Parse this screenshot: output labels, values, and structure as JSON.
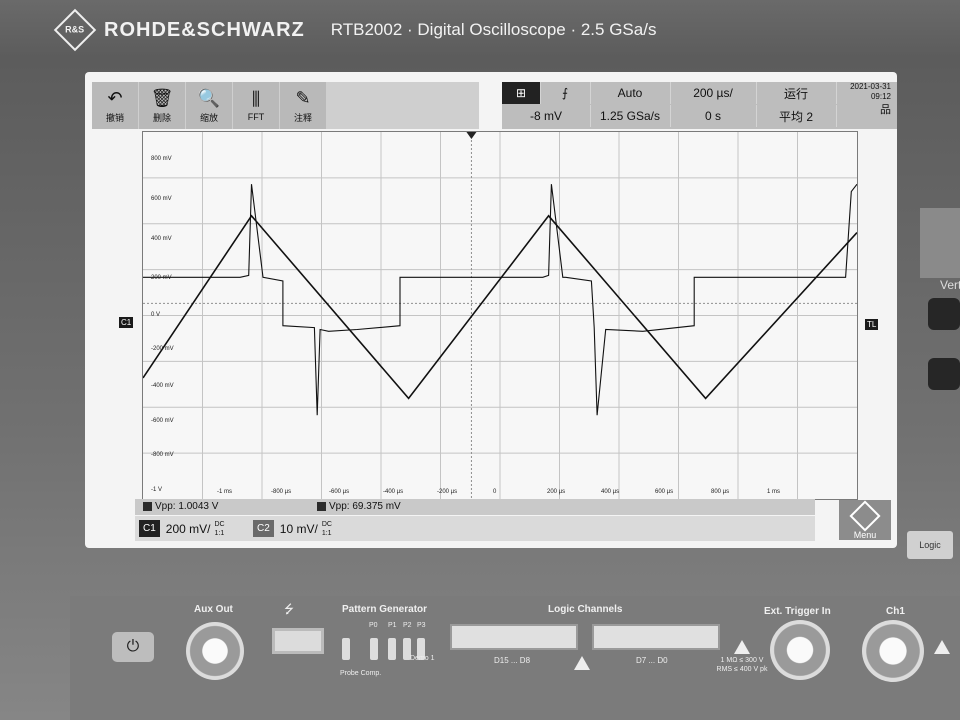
{
  "header": {
    "brand": "ROHDE&SCHWARZ",
    "model": "RTB2002 · Digital Oscilloscope · 2.5 GSa/s",
    "logo_letters": "R&S"
  },
  "toolbar": [
    {
      "label": "撤销",
      "icon": "undo-icon",
      "glyph": "↶"
    },
    {
      "label": "删除",
      "icon": "trash-icon",
      "glyph": "🗑"
    },
    {
      "label": "缩放",
      "icon": "zoom-icon",
      "glyph": "🔍"
    },
    {
      "label": "FFT",
      "icon": "fft-icon",
      "glyph": "⫼"
    },
    {
      "label": "注释",
      "icon": "pencil-icon",
      "glyph": "✎"
    }
  ],
  "status": {
    "trigger_level": "-8 mV",
    "trigger_mode": "Auto",
    "sample_rate": "1.25 GSa/s",
    "timebase": "200 µs/",
    "time_offset": "0 s",
    "run_state": "运行",
    "acquire": "平均 2",
    "date": "2021-03-31",
    "time": "09:12",
    "edge_symbol": "⨍"
  },
  "y_ticks": [
    "800 mV",
    "600 mV",
    "400 mV",
    "200 mV",
    "0 V",
    "-200 mV",
    "-400 mV",
    "-600 mV",
    "-800 mV",
    "-1 V"
  ],
  "x_ticks": [
    "-1 ms",
    "-800 µs",
    "-600 µs",
    "-400 µs",
    "-200 µs",
    "0",
    "200 µs",
    "400 µs",
    "600 µs",
    "800 µs",
    "1 ms"
  ],
  "markers": {
    "ch_left": "C1",
    "trig_right": "TL"
  },
  "measurements": [
    {
      "label": "Vpp: 1.0043 V"
    },
    {
      "label": "Vpp: 69.375 mV"
    }
  ],
  "channels": [
    {
      "tag": "C1",
      "scale": "200 mV/",
      "coupling": "DC",
      "impedance": "1:1"
    },
    {
      "tag": "C2",
      "scale": "10 mV/",
      "coupling": "DC",
      "impedance": "1:1"
    }
  ],
  "menu_label": "Menu",
  "side": {
    "vertical_label": "Vert",
    "logic_button": "Logic"
  },
  "front": {
    "aux_out": "Aux Out",
    "pattern_gen": "Pattern Generator",
    "pins": [
      "P0",
      "P1",
      "P2",
      "P3"
    ],
    "probe_comp": "Probe Comp.",
    "demo": "Demo 1",
    "logic_channels": "Logic Channels",
    "d_high": "D15 ... D8",
    "d_low": "D7 ... D0",
    "ext_trigger": "Ext. Trigger In",
    "ext_spec": "1 MΩ ≤ 300 V RMS ≤ 400 V pk",
    "ch1": "Ch1"
  },
  "chart_data": {
    "type": "line",
    "xlabel": "",
    "ylabel": "",
    "xlim": [
      -1.15,
      1.35
    ],
    "ylim": [
      -1.05,
      0.92
    ],
    "grid": true,
    "series": [
      {
        "x": [
          -1.15,
          -0.77,
          -0.22,
          0.27,
          0.82,
          1.35
        ],
        "y": [
          -0.4,
          0.47,
          -0.51,
          0.47,
          -0.51,
          0.38
        ]
      },
      {
        "x": [
          -1.15,
          -0.81,
          -0.78,
          -0.77,
          -0.73,
          -0.73,
          -0.66,
          -0.66,
          -0.55,
          -0.54,
          -0.53,
          -0.5,
          -0.4,
          -0.25,
          -0.25,
          0.25,
          0.27,
          0.28,
          0.32,
          0.33,
          0.42,
          0.43,
          0.44,
          0.47,
          0.6,
          0.78,
          0.78,
          1.31,
          1.33,
          1.35
        ],
        "y": [
          0.14,
          0.14,
          0.15,
          0.64,
          0.14,
          0.14,
          0.12,
          -0.12,
          -0.13,
          -0.6,
          -0.14,
          -0.15,
          -0.14,
          -0.12,
          0.14,
          0.14,
          0.15,
          0.64,
          0.14,
          0.14,
          0.12,
          -0.13,
          -0.6,
          -0.14,
          -0.15,
          -0.12,
          0.14,
          0.14,
          0.6,
          0.64
        ]
      }
    ]
  }
}
